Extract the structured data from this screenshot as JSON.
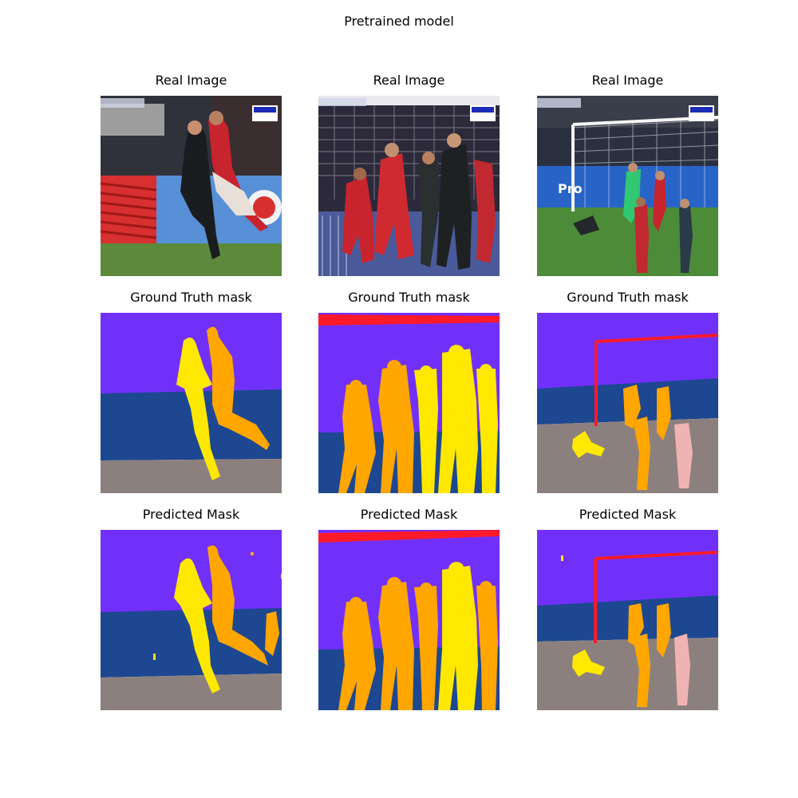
{
  "figure": {
    "suptitle": "Pretrained model",
    "rows": [
      {
        "row_title": "Real Image",
        "panels": [
          {
            "title": "Real Image",
            "kind": "real",
            "scene": "Close-up of players in black no. 10 kit and red kit in front of advertising board"
          },
          {
            "title": "Real Image",
            "kind": "real",
            "scene": "Players in red and black kits grouped in front of goal net"
          },
          {
            "title": "Real Image",
            "kind": "real",
            "scene": "Wide view of goal area with goalkeeper, players and referee"
          }
        ]
      },
      {
        "row_title": "Ground Truth mask",
        "panels": [
          {
            "title": "Ground Truth mask",
            "kind": "mask"
          },
          {
            "title": "Ground Truth mask",
            "kind": "mask"
          },
          {
            "title": "Ground Truth mask",
            "kind": "mask"
          }
        ]
      },
      {
        "row_title": "Predicted Mask",
        "panels": [
          {
            "title": "Predicted Mask",
            "kind": "mask"
          },
          {
            "title": "Predicted Mask",
            "kind": "mask"
          },
          {
            "title": "Predicted Mask",
            "kind": "mask"
          }
        ]
      }
    ],
    "mask_colors": {
      "background": "#7130fa",
      "advertisement": "#1d4791",
      "field": "#8c807e",
      "team_a": "#ffa600",
      "team_b": "#ffe800",
      "goal": "#ff1a2a",
      "referee": "#f0b3b3"
    }
  }
}
